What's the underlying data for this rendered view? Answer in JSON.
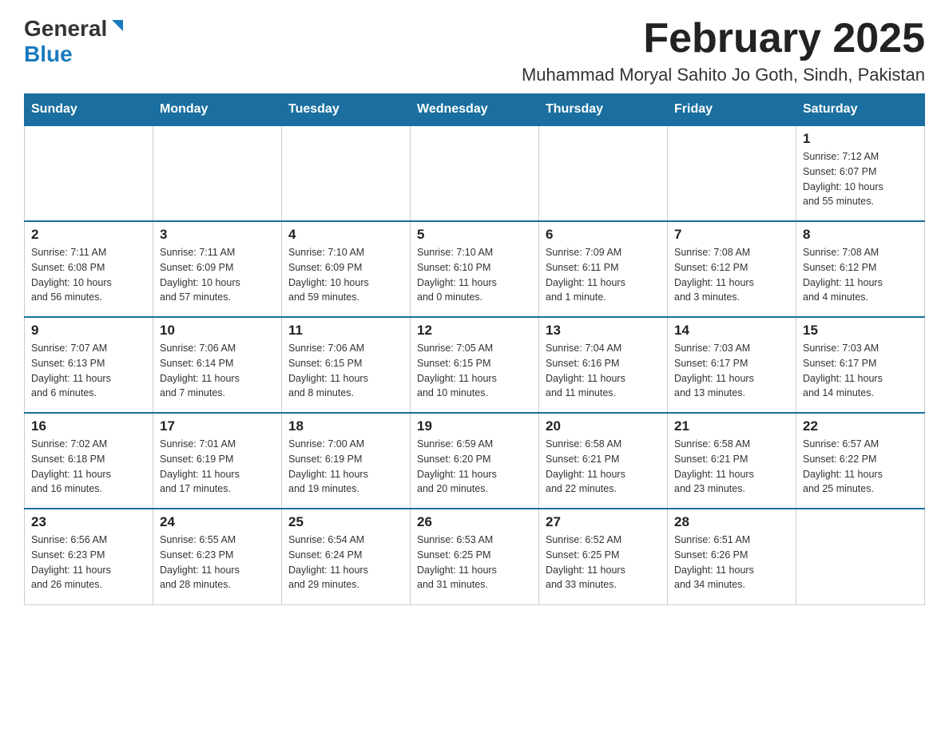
{
  "header": {
    "logo_general": "General",
    "logo_blue": "Blue",
    "month_title": "February 2025",
    "location": "Muhammad Moryal Sahito Jo Goth, Sindh, Pakistan"
  },
  "weekdays": [
    "Sunday",
    "Monday",
    "Tuesday",
    "Wednesday",
    "Thursday",
    "Friday",
    "Saturday"
  ],
  "weeks": [
    [
      {
        "day": "",
        "info": ""
      },
      {
        "day": "",
        "info": ""
      },
      {
        "day": "",
        "info": ""
      },
      {
        "day": "",
        "info": ""
      },
      {
        "day": "",
        "info": ""
      },
      {
        "day": "",
        "info": ""
      },
      {
        "day": "1",
        "info": "Sunrise: 7:12 AM\nSunset: 6:07 PM\nDaylight: 10 hours\nand 55 minutes."
      }
    ],
    [
      {
        "day": "2",
        "info": "Sunrise: 7:11 AM\nSunset: 6:08 PM\nDaylight: 10 hours\nand 56 minutes."
      },
      {
        "day": "3",
        "info": "Sunrise: 7:11 AM\nSunset: 6:09 PM\nDaylight: 10 hours\nand 57 minutes."
      },
      {
        "day": "4",
        "info": "Sunrise: 7:10 AM\nSunset: 6:09 PM\nDaylight: 10 hours\nand 59 minutes."
      },
      {
        "day": "5",
        "info": "Sunrise: 7:10 AM\nSunset: 6:10 PM\nDaylight: 11 hours\nand 0 minutes."
      },
      {
        "day": "6",
        "info": "Sunrise: 7:09 AM\nSunset: 6:11 PM\nDaylight: 11 hours\nand 1 minute."
      },
      {
        "day": "7",
        "info": "Sunrise: 7:08 AM\nSunset: 6:12 PM\nDaylight: 11 hours\nand 3 minutes."
      },
      {
        "day": "8",
        "info": "Sunrise: 7:08 AM\nSunset: 6:12 PM\nDaylight: 11 hours\nand 4 minutes."
      }
    ],
    [
      {
        "day": "9",
        "info": "Sunrise: 7:07 AM\nSunset: 6:13 PM\nDaylight: 11 hours\nand 6 minutes."
      },
      {
        "day": "10",
        "info": "Sunrise: 7:06 AM\nSunset: 6:14 PM\nDaylight: 11 hours\nand 7 minutes."
      },
      {
        "day": "11",
        "info": "Sunrise: 7:06 AM\nSunset: 6:15 PM\nDaylight: 11 hours\nand 8 minutes."
      },
      {
        "day": "12",
        "info": "Sunrise: 7:05 AM\nSunset: 6:15 PM\nDaylight: 11 hours\nand 10 minutes."
      },
      {
        "day": "13",
        "info": "Sunrise: 7:04 AM\nSunset: 6:16 PM\nDaylight: 11 hours\nand 11 minutes."
      },
      {
        "day": "14",
        "info": "Sunrise: 7:03 AM\nSunset: 6:17 PM\nDaylight: 11 hours\nand 13 minutes."
      },
      {
        "day": "15",
        "info": "Sunrise: 7:03 AM\nSunset: 6:17 PM\nDaylight: 11 hours\nand 14 minutes."
      }
    ],
    [
      {
        "day": "16",
        "info": "Sunrise: 7:02 AM\nSunset: 6:18 PM\nDaylight: 11 hours\nand 16 minutes."
      },
      {
        "day": "17",
        "info": "Sunrise: 7:01 AM\nSunset: 6:19 PM\nDaylight: 11 hours\nand 17 minutes."
      },
      {
        "day": "18",
        "info": "Sunrise: 7:00 AM\nSunset: 6:19 PM\nDaylight: 11 hours\nand 19 minutes."
      },
      {
        "day": "19",
        "info": "Sunrise: 6:59 AM\nSunset: 6:20 PM\nDaylight: 11 hours\nand 20 minutes."
      },
      {
        "day": "20",
        "info": "Sunrise: 6:58 AM\nSunset: 6:21 PM\nDaylight: 11 hours\nand 22 minutes."
      },
      {
        "day": "21",
        "info": "Sunrise: 6:58 AM\nSunset: 6:21 PM\nDaylight: 11 hours\nand 23 minutes."
      },
      {
        "day": "22",
        "info": "Sunrise: 6:57 AM\nSunset: 6:22 PM\nDaylight: 11 hours\nand 25 minutes."
      }
    ],
    [
      {
        "day": "23",
        "info": "Sunrise: 6:56 AM\nSunset: 6:23 PM\nDaylight: 11 hours\nand 26 minutes."
      },
      {
        "day": "24",
        "info": "Sunrise: 6:55 AM\nSunset: 6:23 PM\nDaylight: 11 hours\nand 28 minutes."
      },
      {
        "day": "25",
        "info": "Sunrise: 6:54 AM\nSunset: 6:24 PM\nDaylight: 11 hours\nand 29 minutes."
      },
      {
        "day": "26",
        "info": "Sunrise: 6:53 AM\nSunset: 6:25 PM\nDaylight: 11 hours\nand 31 minutes."
      },
      {
        "day": "27",
        "info": "Sunrise: 6:52 AM\nSunset: 6:25 PM\nDaylight: 11 hours\nand 33 minutes."
      },
      {
        "day": "28",
        "info": "Sunrise: 6:51 AM\nSunset: 6:26 PM\nDaylight: 11 hours\nand 34 minutes."
      },
      {
        "day": "",
        "info": ""
      }
    ]
  ]
}
